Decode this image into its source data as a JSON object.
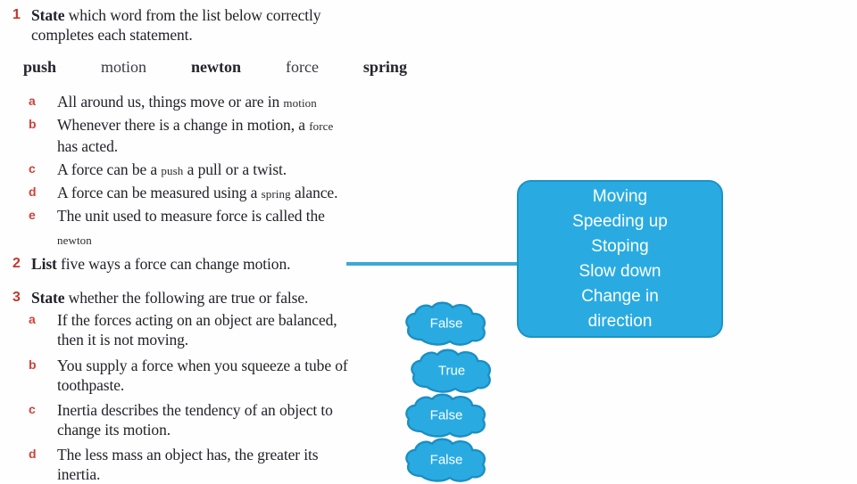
{
  "theme": {
    "accent_blue": "#29ABE2",
    "accent_blue_dark": "#1d93c6",
    "connector_blue": "#3aaad6",
    "marker_red": "#c0392f",
    "letter_red": "#d0413a",
    "text_dark": "#22222a",
    "page_bg": "#ffffff"
  },
  "worksheet": {
    "questions": [
      {
        "number": "1",
        "command": "State",
        "prompt_line1": " which word from the list below correctly",
        "prompt_line2": "completes each statement.",
        "word_list": [
          "push",
          "motion",
          "newton",
          "force",
          "spring"
        ],
        "items": [
          {
            "letter": "a",
            "text": "All around us, things move or are in",
            "answer": "motion"
          },
          {
            "letter": "b",
            "text": "Whenever there is a change in motion, a",
            "answer": "force",
            "text_line2": "has acted."
          },
          {
            "letter": "c",
            "text_pre": "A force can be a",
            "answer": "push",
            "text_post": "a pull or a twist."
          },
          {
            "letter": "d",
            "text_pre": "A force can be measured using a",
            "answer": "spring",
            "text_post": "alance."
          },
          {
            "letter": "e",
            "text": "The unit used to measure force is called the",
            "answer": "newton"
          }
        ]
      },
      {
        "number": "2",
        "command": "List",
        "prompt_line1": " five ways a force can change motion.",
        "answer_box_lines": [
          "Moving",
          "Speeding up",
          "Stoping",
          "Slow down",
          "Change in",
          "direction"
        ]
      },
      {
        "number": "3",
        "command": "State",
        "prompt_line1": " whether the following are true or false.",
        "items": [
          {
            "letter": "a",
            "text_line1": "If the forces acting on an object are balanced,",
            "text_line2": "then it is not moving.",
            "answer": "False"
          },
          {
            "letter": "b",
            "text_line1": "You supply a force when you squeeze a tube of",
            "text_line2": "toothpaste.",
            "answer": "True"
          },
          {
            "letter": "c",
            "text_line1": "Inertia describes the tendency of an object to",
            "text_line2": "change its motion.",
            "answer": "False"
          },
          {
            "letter": "d",
            "text_line1": "The less mass an object has, the greater its",
            "text_line2": "inertia.",
            "answer": "False"
          }
        ]
      }
    ]
  }
}
